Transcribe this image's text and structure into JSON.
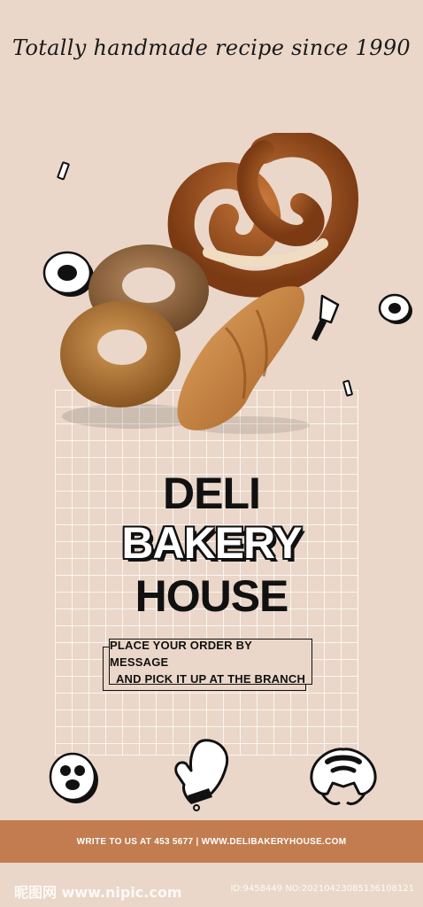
{
  "header": {
    "tagline": "Totally handmade recipe since 1990"
  },
  "title": {
    "line1": "DELI",
    "line2": "BAKERY",
    "line3": "HOUSE"
  },
  "order_box": {
    "line1": "PLACE YOUR ORDER BY MESSAGE",
    "line2": "AND PICK IT UP AT THE BRANCH"
  },
  "footer": {
    "contact": "WRITE TO US AT 453 5677 | WWW.DELIBAKERYHOUSE.COM"
  },
  "watermark": {
    "left": "昵图网 www.nipic.com",
    "right": "ID:9458449 NO:20210423085136108121"
  },
  "icons": [
    "pretzel-icon",
    "oven-mitt-icon",
    "croissant-icon",
    "knife-icon",
    "donut-icon"
  ],
  "colors": {
    "background": "#ead7c9",
    "footer": "#c27c4f",
    "text": "#111111"
  }
}
